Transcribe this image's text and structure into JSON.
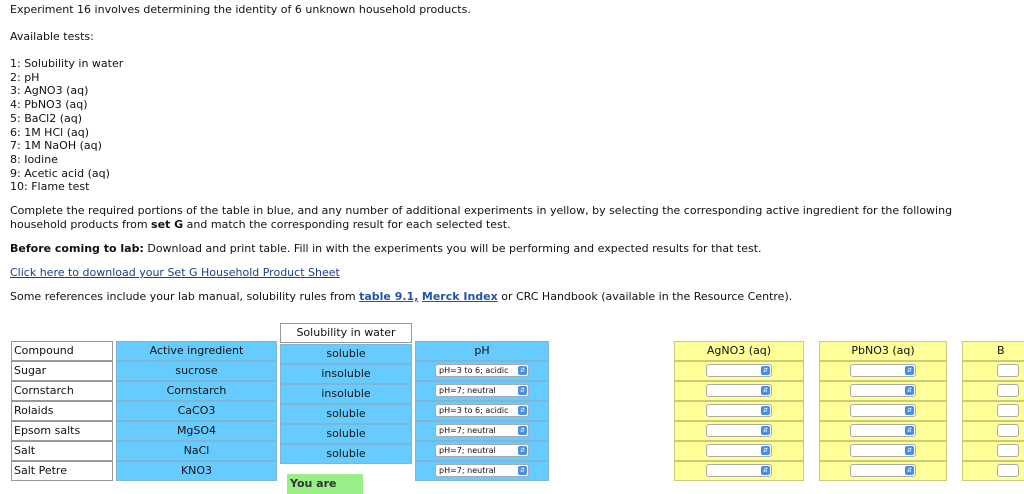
{
  "intro": "Experiment 16 involves determining the identity of 6 unknown household products.",
  "available_tests_label": "Available tests:",
  "tests": [
    "1: Solubility in water",
    "2: pH",
    "3: AgNO3 (aq)",
    "4: PbNO3 (aq)",
    "5: BaCl2 (aq)",
    "6: 1M HCl (aq)",
    "7: 1M NaOH (aq)",
    "8: Iodine",
    "9: Acetic acid (aq)",
    "10: Flame test"
  ],
  "instructions": {
    "part1": "Complete the required portions of the table in blue, and any number of additional experiments in yellow, by selecting the corresponding active ingredient for the following household products from ",
    "set_name": "set G",
    "part2": " and match the corresponding result for each selected test."
  },
  "before_lab": {
    "label": "Before coming to lab:",
    "text": " Download and print table. Fill in with the experiments you will be performing and expected results for that test."
  },
  "download_link": "Click here to download your Set G Household Product Sheet",
  "references": {
    "part1": "Some references include your lab manual, solubility rules from ",
    "ref1": "table 9.1,",
    "ref2": "Merck Index",
    "part2": " or CRC Handbook (available in the Resource Centre)."
  },
  "table": {
    "headers": {
      "compound": "Compound",
      "active": "Active ingredient",
      "solubility": "Solubility in water",
      "ph": "pH",
      "agno3": "AgNO3 (aq)",
      "pbno3": "PbNO3 (aq)",
      "b_partial": "B"
    },
    "rows": [
      {
        "compound": "Sugar",
        "active": "sucrose",
        "solubility": "soluble",
        "ph": "pH=3 to 6; acidic"
      },
      {
        "compound": "Cornstarch",
        "active": "Cornstarch",
        "solubility": "insoluble",
        "ph": "pH=7; neutral"
      },
      {
        "compound": "Rolaids",
        "active": "CaCO3",
        "solubility": "insoluble",
        "ph": "pH=3 to 6; acidic"
      },
      {
        "compound": "Epsom salts",
        "active": "MgSO4",
        "solubility": "soluble",
        "ph": "pH=7; neutral"
      },
      {
        "compound": "Salt",
        "active": "NaCl",
        "solubility": "soluble",
        "ph": "pH=7; neutral"
      },
      {
        "compound": "Salt Petre",
        "active": "KNO3",
        "solubility": "soluble",
        "ph": "pH=7; neutral"
      }
    ]
  },
  "result_badge": "You are",
  "icons": {
    "select_arrow": "updown-arrow-icon"
  },
  "colors": {
    "required": "#66ccff",
    "optional": "#ffff99",
    "badge": "#99ee88",
    "link": "#1a3e8c"
  }
}
